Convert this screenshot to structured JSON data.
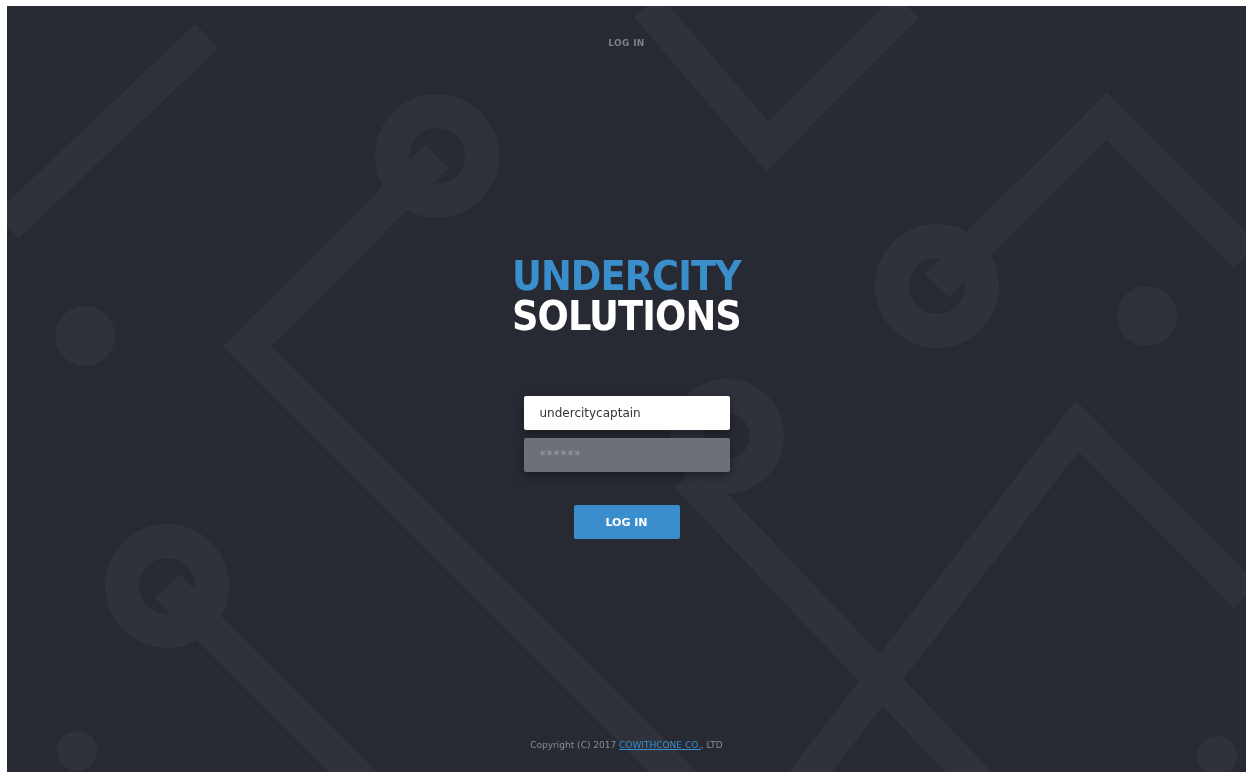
{
  "header": {
    "title": "LOG IN"
  },
  "logo": {
    "line_1": "UNDERCITY",
    "line_2": "SOLUTIONS"
  },
  "form": {
    "username": {
      "value": "undercitycaptain"
    },
    "password": {
      "placeholder": "******"
    },
    "submit": "LOG IN"
  },
  "footer": {
    "prefix": "Copyright (C) 2017 ",
    "link": "COWITHCONE CO.",
    "suffix": ", LTD"
  }
}
